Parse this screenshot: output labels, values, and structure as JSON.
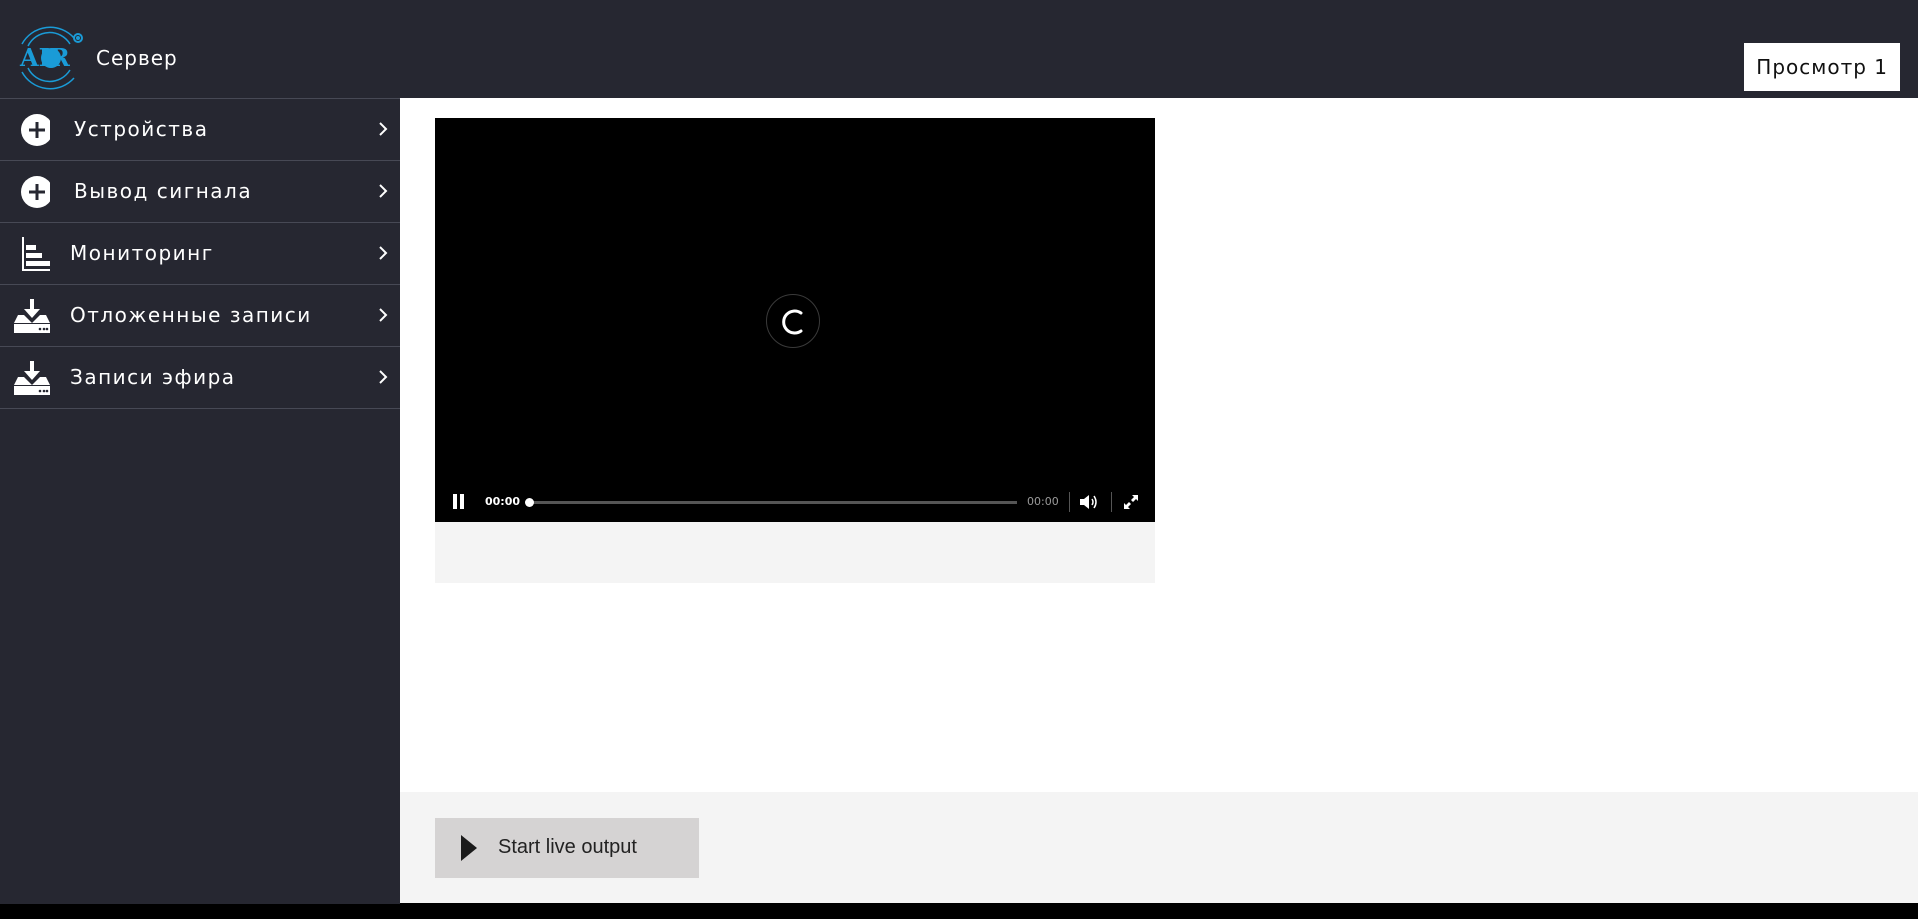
{
  "header": {
    "logo_text": "AIR",
    "title": "Сервер",
    "view_button_label": "Просмотр 1"
  },
  "sidebar": {
    "items": [
      {
        "label": "Устройства",
        "icon": "plus-circle-icon"
      },
      {
        "label": "Вывод сигнала",
        "icon": "plus-circle-icon"
      },
      {
        "label": "Мониторинг",
        "icon": "bar-chart-icon"
      },
      {
        "label": "Отложенные записи",
        "icon": "download-tray-icon"
      },
      {
        "label": "Записи эфира",
        "icon": "download-tray-icon"
      }
    ]
  },
  "player": {
    "state": "loading",
    "current_time": "00:00",
    "duration": "00:00",
    "progress": 0
  },
  "footer": {
    "start_button_label": "Start live output"
  },
  "colors": {
    "header_bg": "#262731",
    "sidebar_bg": "#262731",
    "logo_accent": "#1a9bd7",
    "main_bg": "#ffffff",
    "footer_bg": "#f4f4f4",
    "button_bg": "#d5d3d3"
  }
}
